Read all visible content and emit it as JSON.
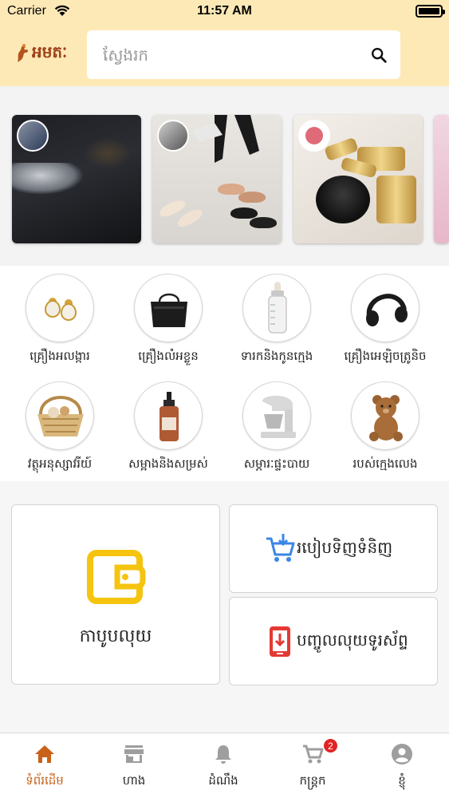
{
  "status_bar": {
    "carrier": "Carrier",
    "time": "11:57 AM"
  },
  "header": {
    "logo_text": "អមតៈ",
    "search": {
      "placeholder": "ស្វែងរក",
      "value": ""
    }
  },
  "banners": [
    {
      "name": "banner-car-night"
    },
    {
      "name": "banner-shoes"
    },
    {
      "name": "banner-cosmetics"
    },
    {
      "name": "banner-partial"
    }
  ],
  "categories": [
    {
      "label": "គ្រឿងអលង្ការ",
      "icon": "earrings-icon"
    },
    {
      "label": "គ្រឿងលំអខ្លួន",
      "icon": "handbag-icon"
    },
    {
      "label": "ទារកនិងកូនក្មេង",
      "icon": "baby-bottle-icon"
    },
    {
      "label": "គ្រឿងអេឡិចត្រូនិច",
      "icon": "headphones-icon"
    },
    {
      "label": "វត្ថុអនុស្សាវរីយ៍",
      "icon": "gift-basket-icon"
    },
    {
      "label": "សម្អាងនិងសម្រស់",
      "icon": "cosmetic-bottle-icon"
    },
    {
      "label": "សម្ភារៈផ្ទះបាយ",
      "icon": "stand-mixer-icon"
    },
    {
      "label": "របស់ក្មេងលេង",
      "icon": "teddy-bear-icon"
    }
  ],
  "cards": {
    "wallet": {
      "label": "កាបូបលុយ",
      "icon": "wallet-icon",
      "color": "#f5c40f"
    },
    "orders": {
      "label": "របៀបទិញទំនិញ",
      "icon": "cart-download-icon",
      "color": "#3b86e6"
    },
    "topup": {
      "label": "បញ្ចូលលុយទូរស័ព្ទ",
      "icon": "phone-topup-icon",
      "color": "#e53935"
    }
  },
  "tabbar": {
    "tabs": [
      {
        "label": "ទំព័រដើម",
        "icon": "home-icon",
        "active": true
      },
      {
        "label": "ហាង",
        "icon": "store-icon",
        "active": false
      },
      {
        "label": "ដំណឹង",
        "icon": "bell-icon",
        "active": false
      },
      {
        "label": "កន្ត្រក",
        "icon": "cart-icon",
        "active": false,
        "badge": "2"
      },
      {
        "label": "ខ្ញុំ",
        "icon": "user-icon",
        "active": false
      }
    ],
    "active_color": "#c8621a",
    "inactive_color": "#9e9e9e"
  }
}
